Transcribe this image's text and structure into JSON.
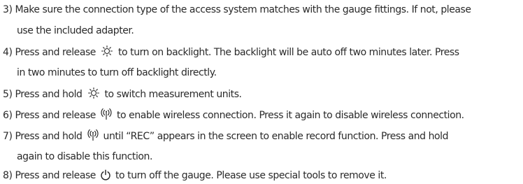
{
  "instructions": {
    "step3": {
      "line1": "3) Make sure the connection type of the access system matches with the gauge fittings. If not, please",
      "line2": "use the included adapter."
    },
    "step4": {
      "before_icon": "4) Press and release",
      "after_icon": "to turn on backlight. The backlight will be auto off two minutes later. Press",
      "line2": "in two minutes to turn off backlight directly.",
      "icon": "backlight-icon"
    },
    "step5": {
      "before_icon": "5) Press and hold",
      "after_icon": "to switch measurement units.",
      "icon": "backlight-icon"
    },
    "step6": {
      "before_icon": "6) Press and release",
      "after_icon": "to enable wireless connection. Press it again to disable wireless connection.",
      "icon": "wireless-icon"
    },
    "step7": {
      "before_icon": "7) Press and hold",
      "after_icon": "until “REC” appears in the screen to enable record function. Press and hold",
      "line2": "again to disable this function.",
      "icon": "wireless-icon"
    },
    "step8": {
      "before_icon": "8) Press and release",
      "after_icon": "to turn off the gauge. Please use special tools to remove it.",
      "icon": "power-icon"
    }
  },
  "colors": {
    "text": "#2a2a2a",
    "background": "#ffffff"
  }
}
